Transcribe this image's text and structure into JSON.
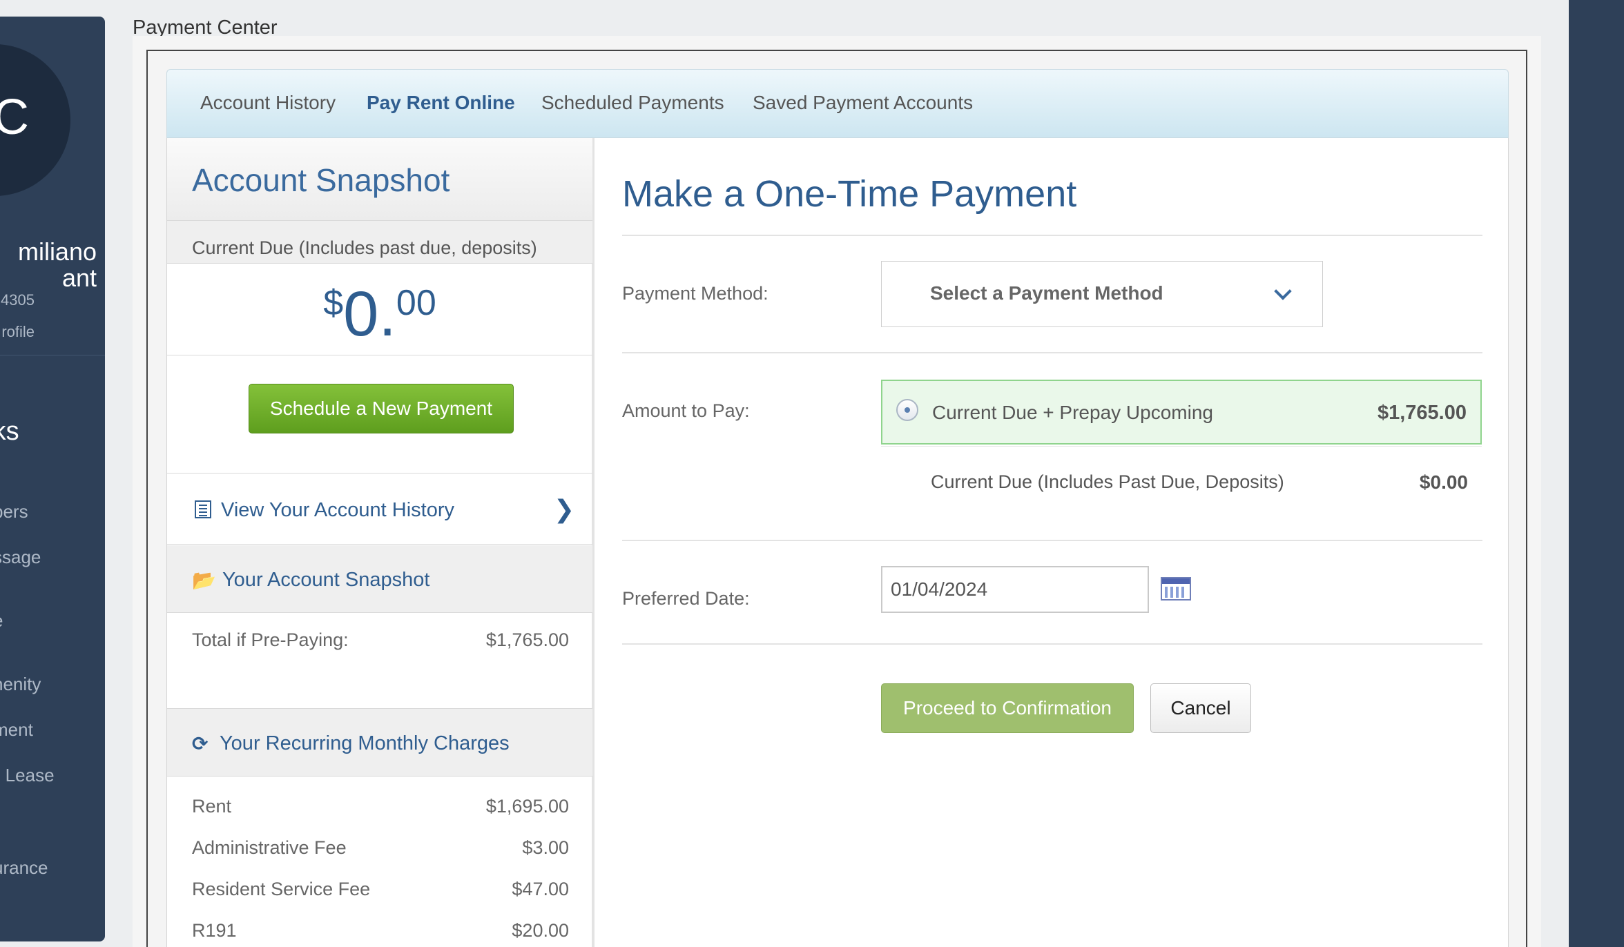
{
  "sidebar": {
    "avatar_initial": "C",
    "user_name_line1": "miliano",
    "user_name_line2": "ant",
    "user_id": "4305",
    "profile_link": "rofile",
    "links_heading": "inks",
    "items": [
      "bers",
      "ssage",
      "e",
      "nenity",
      "ment",
      "e Lease",
      "urance"
    ]
  },
  "page": {
    "title": "Payment Center"
  },
  "tabs": [
    "Account History",
    "Pay Rent Online",
    "Scheduled Payments",
    "Saved Payment Accounts"
  ],
  "active_tab": "Pay Rent Online",
  "snapshot": {
    "title": "Account Snapshot",
    "current_due_label": "Current Due (Includes past due, deposits)",
    "current_due": {
      "currency": "$",
      "dollars": "0",
      "dot": ".",
      "cents": "00"
    },
    "schedule_button": "Schedule a New Payment",
    "history_link": "View Your Account History",
    "your_snapshot": {
      "heading": "Your Account Snapshot",
      "total_label": "Total if Pre-Paying:",
      "total_value": "$1,765.00"
    },
    "recurring": {
      "heading": "Your Recurring Monthly Charges",
      "items": [
        {
          "label": "Rent",
          "value": "$1,695.00"
        },
        {
          "label": "Administrative Fee",
          "value": "$3.00"
        },
        {
          "label": "Resident Service Fee",
          "value": "$47.00"
        },
        {
          "label": "R191",
          "value": "$20.00"
        }
      ]
    }
  },
  "payment": {
    "title": "Make a One-Time Payment",
    "method_label": "Payment Method:",
    "method_select": "Select a Payment Method",
    "amount_label": "Amount to Pay:",
    "options": [
      {
        "label": "Current Due + Prepay Upcoming",
        "amount": "$1,765.00",
        "selected": true
      },
      {
        "label": "Current Due (Includes Past Due, Deposits)",
        "amount": "$0.00",
        "selected": false
      }
    ],
    "date_label": "Preferred Date:",
    "date_value": "01/04/2024",
    "proceed_button": "Proceed to Confirmation",
    "cancel_button": "Cancel"
  },
  "colors": {
    "sidebar_bg": "#2e4058",
    "accent_blue": "#2f5d8f",
    "green_button": "#6aa82a"
  }
}
